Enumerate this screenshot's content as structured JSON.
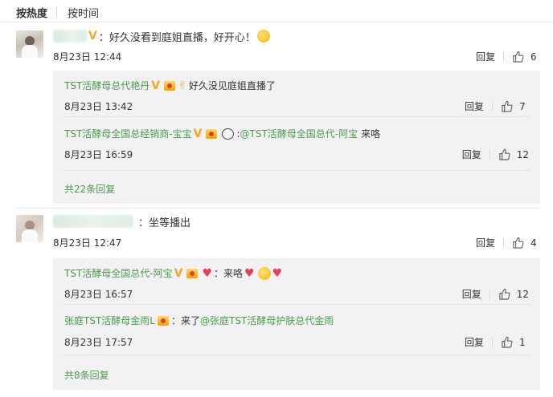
{
  "sort": {
    "hot_label": "按热度",
    "time_label": "按时间"
  },
  "comments": [
    {
      "text": "：好久没看到庭姐直播，好开心！",
      "time": "8月23日 12:44",
      "reply_label": "回复",
      "likes": "6",
      "replies": [
        {
          "user": "TST活酵母总代艳丹",
          "text": "好久没见庭姐直播了",
          "time": "8月23日 13:42",
          "reply_label": "回复",
          "likes": "7"
        },
        {
          "user": "TST活酵母全国总经销商-宝宝",
          "mention": "@TST活酵母全国总代-阿宝",
          "text": "来咯",
          "time": "8月23日 16:59",
          "reply_label": "回复",
          "likes": "12"
        }
      ],
      "more": "共22条回复"
    },
    {
      "text": "：坐等播出",
      "time": "8月23日 12:47",
      "reply_label": "回复",
      "likes": "4",
      "replies": [
        {
          "user": "TST活酵母全国总代-阿宝",
          "text": "：来咯",
          "time": "8月23日 16:57",
          "reply_label": "回复",
          "likes": "12"
        },
        {
          "user": "张庭TST活酵母金雨L",
          "prefix": "：来了",
          "mention": "@张庭TST活酵母护肤总代金雨",
          "time": "8月23日 17:57",
          "reply_label": "回复",
          "likes": "1"
        }
      ],
      "more": "共8条回复"
    }
  ],
  "colors": {
    "username": "#4c9a4a",
    "vip": "#f5a623",
    "reply_bg": "#f2f2f5"
  },
  "icons": [
    "thumb-up-icon",
    "vip-icon",
    "emoji-icon",
    "heart-icon",
    "panda-icon",
    "victory-hand-icon"
  ]
}
